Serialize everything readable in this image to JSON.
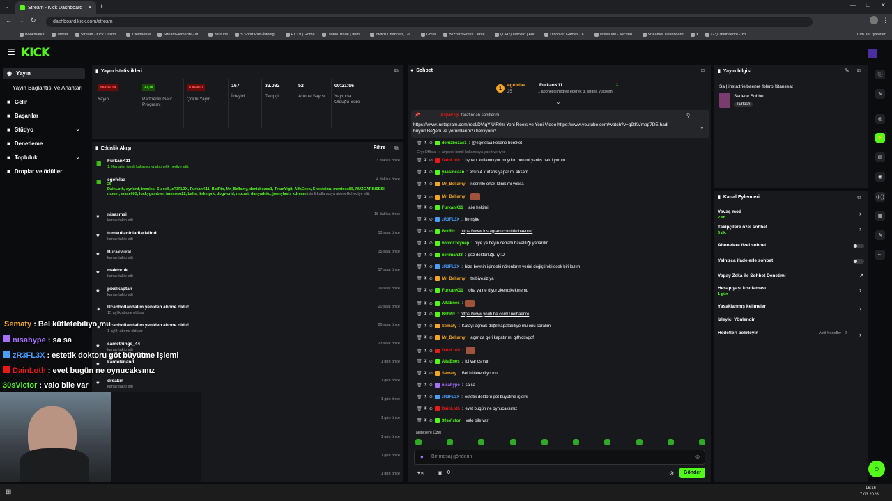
{
  "browser": {
    "tab_title": "Stream - Kick Dashboard",
    "url": "dashboard.kick.com/stream",
    "bookmarks": [
      "Bookmarks",
      "Twitter",
      "Stream - Kick Dashb...",
      "Trielbaenre",
      "StreamElements - M...",
      "Youtube",
      "S Sport Plus-İstediği...",
      "F1 TV | Home",
      "Diablo Trade | Item...",
      "Twitch Channels, Ga...",
      "Gmail",
      "Blizzard Press Cente...",
      "(1342) Discord | Ark...",
      "Discover Games - K...",
      "wowaudit - Ascend...",
      "Streamer Dashboard",
      "X",
      "(23) Trielbaenre - Yo..."
    ],
    "all_bookmarks": "Tüm Yer İşaretleri"
  },
  "logo": "KICK",
  "sidebar": {
    "items": [
      "Yayın",
      "Yayın Bağlantısı ve Anahtarı",
      "Gelir",
      "Başarılar",
      "Stüdyo",
      "Denetleme",
      "Topluluk",
      "Droplar ve ödüller"
    ]
  },
  "stats": {
    "title": "Yayın İstatistikleri",
    "items": [
      {
        "badge": "YAYINDA",
        "label": "Yayın",
        "color": "#e91916"
      },
      {
        "badge": "AÇIK",
        "label": "Partnerlik Gelir Programı",
        "color": "#53fc18"
      },
      {
        "badge": "KAPALI",
        "label": "Çoklu Yayın",
        "color": "#e91916"
      },
      {
        "value": "167",
        "label": "İzleyici"
      },
      {
        "value": "32.082",
        "label": "Takipçi"
      },
      {
        "value": "52",
        "label": "Abone Sayısı"
      },
      {
        "value": "00:21:56",
        "label": "Yayında Olduğu Süre"
      }
    ]
  },
  "activity": {
    "title": "Etkinlik Akışı",
    "filter": "Filtre",
    "events": [
      {
        "name": "FurkanK11",
        "sub": "1. Kartalist isimli kullanıcıya abonelik hediye etti.",
        "time": "3 dakika önce"
      },
      {
        "name": "egefelaa",
        "sub": "DainLoth, cyrlord, iremiss, Suloo5, zR3FL3X, FurkanK11, BotRix, Mr_Bellamy, denizbozac1, TeamYigit, AlfaEnes, Enesteinn, mentoss88, RUZGARINSESI, mbuer, maxe003, luckygambler, iamsoso22, balls, linkinprk, dogworld, mozart, danyadrito, jonnylash, xdream",
        "sub2": "isimli kullanıcıya abonelik hediye etti.",
        "count": "25",
        "time": "4 dakika önce"
      },
      {
        "name": "nisasmsi",
        "sub": "kanalı takip etti",
        "time": "18 dakika önce"
      },
      {
        "name": "tumkullaniciadlarialindi",
        "sub": "kanalı takip etti",
        "time": "13 saat önce"
      },
      {
        "name": "Burakvural",
        "sub": "kanalı takip etti",
        "time": "15 saat önce"
      },
      {
        "name": "maktoruk",
        "sub": "kanalı takip etti",
        "time": "17 saat önce"
      },
      {
        "name": "pixelkaptan",
        "sub": "kanalı takip etti",
        "time": "19 saat önce"
      },
      {
        "name": "Ucanhollandalim yeniden abone oldu!",
        "sub": "15 aylık abone oldular",
        "time": "20 saat önce"
      },
      {
        "name": "Ucanhollandalim yeniden abone oldu!",
        "sub": "1 aylık abone oldular",
        "time": "20 saat önce"
      },
      {
        "name": "samethings_44",
        "sub": "kanalı takip etti",
        "time": "23 saat önce"
      },
      {
        "name": "kardelenand",
        "sub": "",
        "time": "1 gün önce"
      },
      {
        "name": "drsakin",
        "sub": "kanalı takip etti",
        "time": "1 gün önce"
      },
      {
        "name": "",
        "sub": "",
        "time": "1 gün önce"
      },
      {
        "name": "",
        "sub": "",
        "time": "1 gün önce"
      },
      {
        "name": "",
        "sub": "",
        "time": "1 gün önce"
      },
      {
        "name": "",
        "sub": "",
        "time": "1 gün önce"
      },
      {
        "name": "",
        "sub": "",
        "time": "1 gün önce"
      }
    ]
  },
  "chat": {
    "title": "Sohbet",
    "gift_user": "egefelaa",
    "gift_count": "25",
    "gift_top": "FurkanK11",
    "gift_top_count": "1",
    "gift_note": "1 aboneliği hediye ederek 3. sıraya yükselin",
    "pinned_by": "AsyaEzgi",
    "pinned_suffix": "tarafından sabitlendi",
    "pinned_link1": "https://www.instagram.com/reel/DVjqY-UjR0z/",
    "pinned_mid": "Yeni Reels ve Yeni Video",
    "pinned_link2": "https://www.youtube.com/watch?v=g9tKVmpp7DE",
    "pinned_end": "hadi buyur! Beğeni ve yorumlarınızı bekliyoruz.",
    "messages": [
      {
        "user": "denizbozac1",
        "text": "@egefelaa kesene bereket",
        "color": "#53fc18"
      },
      {
        "user": "CryoOfficial",
        "text": "airpods isimli kullanıcıya yanıt veriyor",
        "color": "#888"
      },
      {
        "user": "DainLoth",
        "text": "hyperx kullanmıyor muydun ben mi yanlış hatırlıyorum",
        "color": "#e91916"
      },
      {
        "user": "yaasincaan",
        "text": "ersin 4 kurtarıs yapar mı aksam",
        "color": "#53fc18"
      },
      {
        "user": "Mr_Bellamy",
        "text": "nesrinle ortak klinik mi yoksa",
        "color": "#f5a623"
      },
      {
        "user": "Mr_Bellamy",
        "text": "",
        "color": "#f5a623"
      },
      {
        "user": "FurkanK11",
        "text": "aile hekimi",
        "color": "#53fc18"
      },
      {
        "user": "zR3FL3X",
        "text": "hemşire",
        "color": "#4a9eff"
      },
      {
        "user": "BotRix",
        "text": "https://www.instagram.com/trielbaenre/",
        "color": "#53fc18"
      },
      {
        "user": "volvoxzeynep",
        "text": "niye ya beyin cerrahı havalılığı yapardın",
        "color": "#53fc18"
      },
      {
        "user": "neriman23",
        "text": "göz doktorluğu iyi:D",
        "color": "#53fc18"
      },
      {
        "user": "zR3FL3X",
        "text": "bize beynin içindeki nöronların yerini değiştirebilecek biri lazım",
        "color": "#4a9eff"
      },
      {
        "user": "Mr_Bellamy",
        "text": "terbiyesiz ya",
        "color": "#f5a623"
      },
      {
        "user": "FurkanK11",
        "text": "oha ya ne diyor zkemxkekmemd",
        "color": "#53fc18"
      },
      {
        "user": "AlfaEnes",
        "text": "",
        "color": "#53fc18"
      },
      {
        "user": "BotRix",
        "text": "https://www.youtube.com/Trielbaenre",
        "color": "#53fc18"
      },
      {
        "user": "Sematy",
        "text": "Kafayı açmak değil kapatabiliyo mu onu soralım",
        "color": "#f5a623"
      },
      {
        "user": "Mr_Bellamy",
        "text": "açar da geri kapatır mı gıfhjdsvgdf",
        "color": "#f5a623"
      },
      {
        "user": "DainLoth",
        "text": "",
        "color": "#e91916"
      },
      {
        "user": "AlfaEnes",
        "text": "lol var cs var",
        "color": "#53fc18"
      },
      {
        "user": "Sematy",
        "text": "Bel kütletebiliyo mu",
        "color": "#f5a623"
      },
      {
        "user": "nisahype",
        "text": "sa sa",
        "color": "#a970ff"
      },
      {
        "user": "zR3FL3X",
        "text": "estetik doktoru göt büyütme işlemi",
        "color": "#4a9eff"
      },
      {
        "user": "DainLoth",
        "text": "evet bugün ne oynucaksınız",
        "color": "#e91916"
      },
      {
        "user": "30sVictor",
        "text": "valo bile var",
        "color": "#53fc18"
      }
    ],
    "followers_only": "Takipçilere Özel",
    "input_placeholder": "Bir mesaj gönderin",
    "points": "0",
    "send": "Gönder"
  },
  "stream_info": {
    "title": "Yayın bilgisi",
    "stream_title": "Sa | insta:trielbaenre !blerp !titanseat",
    "category": "Sadece Sohbet",
    "language": "Turkish"
  },
  "channel_actions": {
    "title": "Kanal Eylemleri",
    "items": [
      {
        "label": "Yavaş mod",
        "sub": "2 sn."
      },
      {
        "label": "Takipçilere özel sohbet",
        "sub": "6 dk."
      },
      {
        "label": "Abonelere özel sohbet",
        "sub": ""
      },
      {
        "label": "Yalnızca ifadelerle sohbet",
        "sub": ""
      },
      {
        "label": "Yapay Zeka ile Sohbet Denetimi",
        "sub": ""
      },
      {
        "label": "Hesap yaşı kısıtlaması",
        "sub": "1 gün"
      },
      {
        "label": "Yasaklanmış kelimeler",
        "sub": ""
      },
      {
        "label": "İzleyici Yönlendir",
        "sub": ""
      },
      {
        "label": "Hedefleri belirleyin",
        "sub": ""
      }
    ],
    "goals_status": "Aktif hedefler - 2"
  },
  "overlay": {
    "lines": [
      {
        "user": "Sematy",
        "text": "Bel kütletebiliyo mu",
        "color": "#f5a623"
      },
      {
        "user": "nisahype",
        "text": "sa sa",
        "color": "#a970ff"
      },
      {
        "user": "zR3FL3X",
        "text": "estetik doktoru göt büyütme işlemi",
        "color": "#4a9eff"
      },
      {
        "user": "DainLoth",
        "text": "evet bugün ne oynucaksınız",
        "color": "#e91916"
      },
      {
        "user": "30sVictor",
        "text": "valo bile var",
        "color": "#53fc18"
      }
    ]
  },
  "taskbar": {
    "time": "16:16",
    "date": "7.03.2026"
  }
}
